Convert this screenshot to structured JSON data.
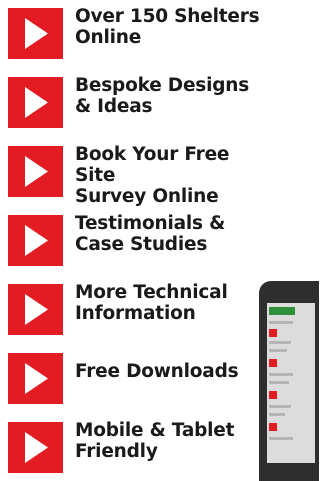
{
  "menu": {
    "items": [
      {
        "label": "Over 150 Shelters\nOnline"
      },
      {
        "label": "Bespoke Designs\n& Ideas"
      },
      {
        "label": "Book Your Free Site\nSurvey Online"
      },
      {
        "label": "Testimonials &\nCase Studies"
      },
      {
        "label": "More Technical\nInformation"
      },
      {
        "label": "Free Downloads"
      },
      {
        "label": "Mobile & Tablet\nFriendly"
      }
    ]
  },
  "colors": {
    "arrow_box": "#e31b23",
    "text": "#1a1a1a",
    "background": "#ffffff"
  },
  "icons": {
    "item_icon": "play-arrow-icon",
    "device_image": "tablet-device-image"
  }
}
